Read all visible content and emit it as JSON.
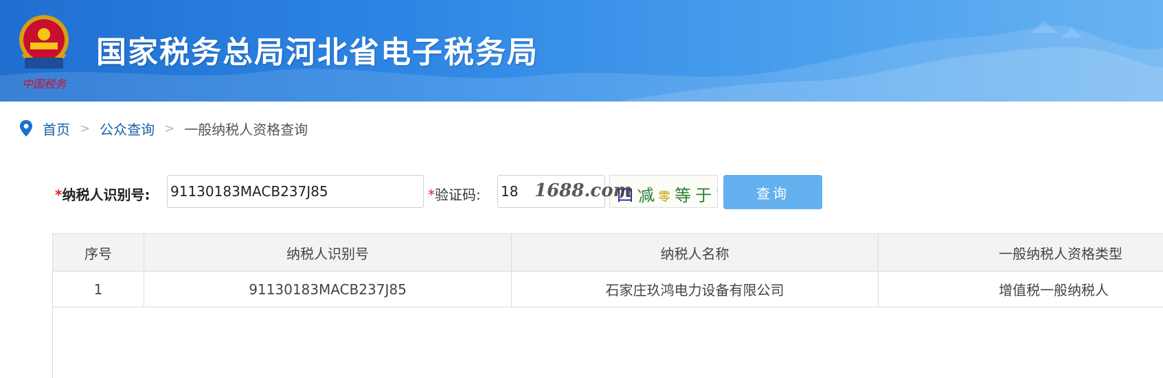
{
  "header": {
    "title": "国家税务总局河北省电子税务局",
    "emblem_caption": "中国税务"
  },
  "breadcrumb": {
    "home": "首页",
    "public_query": "公众查询",
    "current": "一般纳税人资格查询",
    "separator": ">"
  },
  "form": {
    "taxid_required_mark": "*",
    "taxid_label": "纳税人识别号:",
    "taxid_value": "91130183MACB237J85",
    "captcha_required_mark": "*",
    "captcha_label": "验证码:",
    "captcha_value": "18",
    "captcha_image_text": [
      "四",
      "减",
      "零",
      "等于?"
    ],
    "query_button": "查询"
  },
  "watermark": "1688.com",
  "table": {
    "headers": [
      "序号",
      "纳税人识别号",
      "纳税人名称",
      "一般纳税人资格类型"
    ],
    "rows": [
      [
        "1",
        "91130183MACB237J85",
        "石家庄玖鸿电力设备有限公司",
        "增值税一般纳税人"
      ]
    ]
  },
  "colors": {
    "header_blue": "#2e86e4",
    "button_blue": "#64b0ef",
    "link_blue": "#1a5fa8",
    "required_red": "#e02020"
  },
  "icons": {
    "breadcrumb": "location-pin-icon",
    "logo": "tax-emblem-icon"
  }
}
